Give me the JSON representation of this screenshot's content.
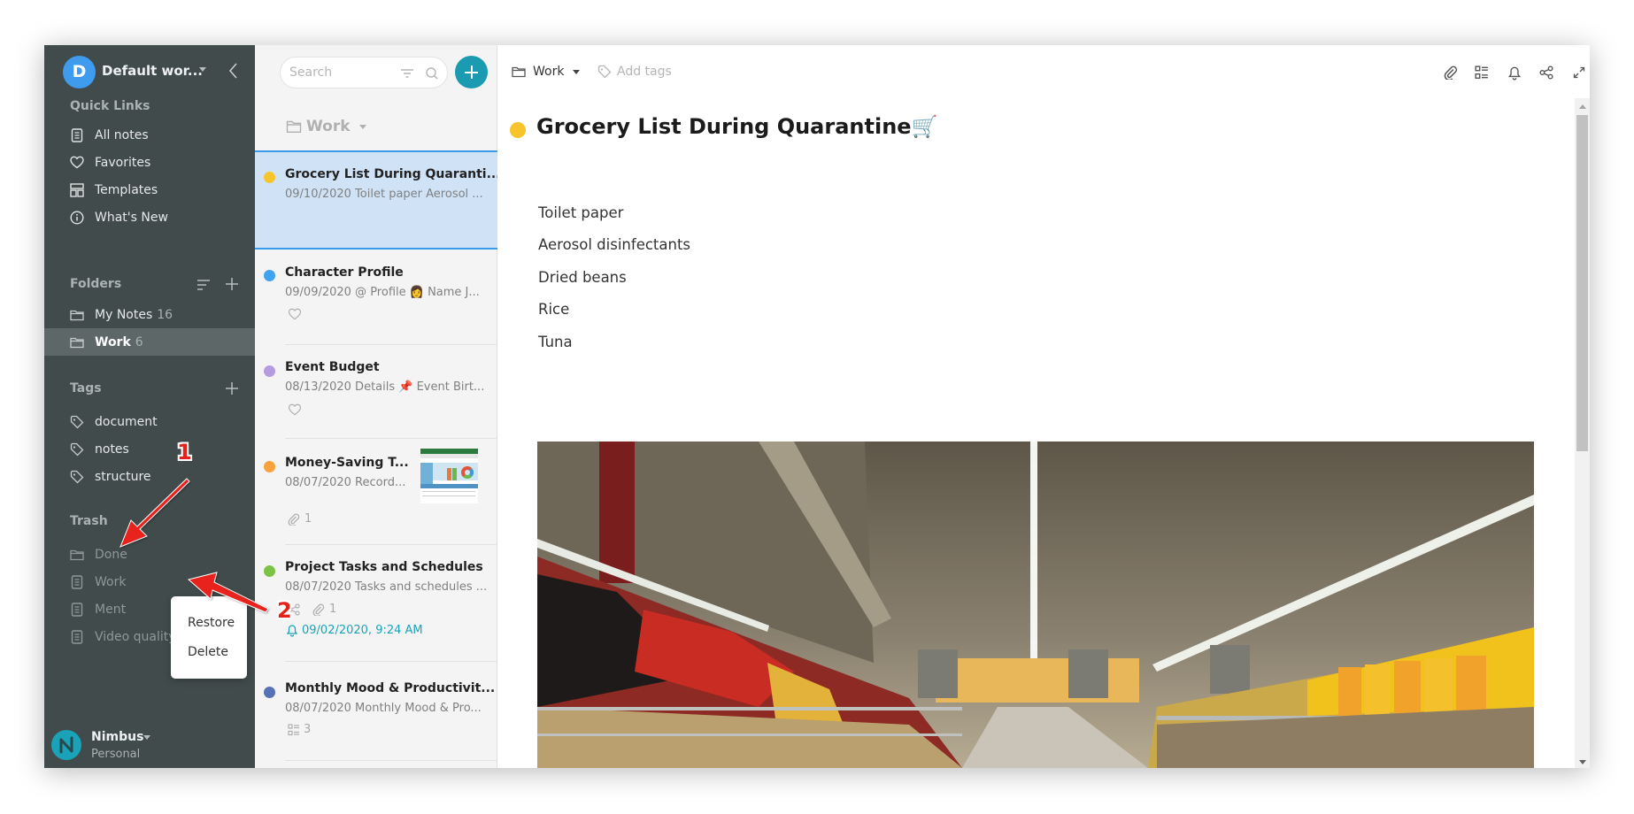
{
  "sidebar": {
    "workspace": {
      "initial": "D",
      "name": "Default wor..."
    },
    "quick_links": {
      "title": "Quick Links",
      "items": [
        {
          "label": "All notes",
          "icon": "note-icon"
        },
        {
          "label": "Favorites",
          "icon": "heart-icon"
        },
        {
          "label": "Templates",
          "icon": "templates-icon"
        },
        {
          "label": "What's New",
          "icon": "info-icon"
        }
      ]
    },
    "folders": {
      "title": "Folders",
      "items": [
        {
          "label": "My Notes",
          "count": "16",
          "active": false
        },
        {
          "label": "Work",
          "count": "6",
          "active": true
        }
      ]
    },
    "tags": {
      "title": "Tags",
      "items": [
        {
          "label": "document"
        },
        {
          "label": "notes"
        },
        {
          "label": "structure"
        }
      ]
    },
    "trash": {
      "title": "Trash",
      "items": [
        {
          "label": "Done",
          "icon": "folder-icon"
        },
        {
          "label": "Work",
          "icon": "note-icon"
        },
        {
          "label": "Ment",
          "icon": "note-icon"
        },
        {
          "label": "Video quality",
          "icon": "note-icon"
        }
      ]
    },
    "user": {
      "name": "Nimbus",
      "plan": "Personal"
    }
  },
  "context_menu": {
    "items": [
      {
        "label": "Restore"
      },
      {
        "label": "Delete"
      }
    ]
  },
  "annotations": {
    "step1": "1",
    "step2": "2",
    "color": "#e8201a"
  },
  "note_list": {
    "search_placeholder": "Search",
    "folder": "Work",
    "notes": [
      {
        "title": "Grocery List During Quaranti...",
        "snippet": "09/10/2020 Toilet paper Aerosol ...",
        "color": "#f7c52b",
        "selected": true
      },
      {
        "title": "Character Profile",
        "snippet": "09/09/2020 @ Profile 👩 Name J...",
        "color": "#3ea3f1",
        "favorite_icon": true
      },
      {
        "title": "Event Budget",
        "snippet": "08/13/2020 Details 📌 Event Birt...",
        "color": "#b59be0",
        "favorite_icon": true
      },
      {
        "title": "Money-Saving T...",
        "snippet": "08/07/2020 Record...",
        "color": "#f9a23b",
        "attachments": "1",
        "has_thumbnail": true
      },
      {
        "title": "Project Tasks and Schedules",
        "snippet": "08/07/2020 Tasks and schedules ...",
        "color": "#7cc244",
        "attachments": "1",
        "shared": true,
        "reminder": "09/02/2020, 9:24 AM"
      },
      {
        "title": "Monthly Mood & Productivit...",
        "snippet": "08/07/2020 Monthly Mood & Pro...",
        "color": "#5472b5",
        "tasks": "3"
      }
    ]
  },
  "editor": {
    "folder": "Work",
    "tags_placeholder": "Add tags",
    "title": "Grocery List During Quarantine🛒",
    "title_color": "#f7c52b",
    "lines": [
      "Toilet paper",
      "Aerosol disinfectants",
      "Dried beans",
      "Rice",
      "Tuna"
    ],
    "toolbar": [
      "attachment-icon",
      "table-of-contents-icon",
      "reminder-bell-icon",
      "share-icon",
      "fullscreen-icon",
      "more-icon"
    ],
    "image_description": "supermarket aisle with snack shelves"
  }
}
